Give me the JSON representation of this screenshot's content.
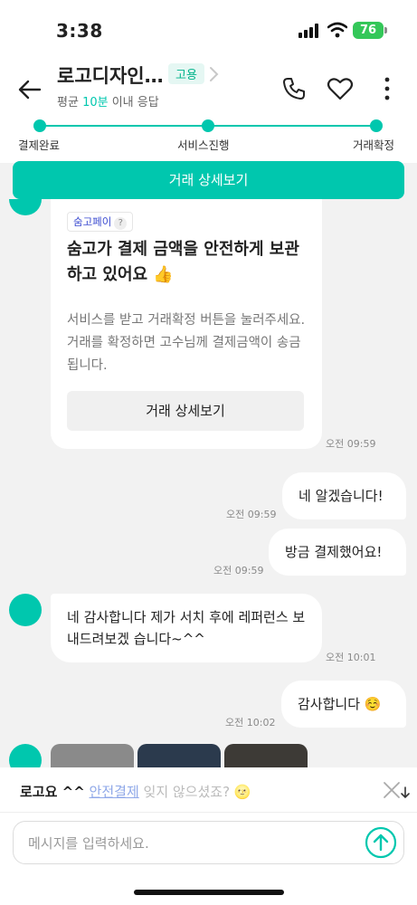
{
  "status_bar": {
    "time": "3:38",
    "battery": "76"
  },
  "header": {
    "title": "로고디자인…",
    "badge": "고용",
    "subtitle_prefix": "평균 ",
    "subtitle_accent": "10분",
    "subtitle_suffix": " 이내 응답"
  },
  "progress": {
    "steps": [
      {
        "label": "결제완료"
      },
      {
        "label": "서비스진행"
      },
      {
        "label": "거래확정"
      }
    ]
  },
  "banner": {
    "label": "거래 상세보기"
  },
  "card": {
    "chip": "숨고페이",
    "help": "?",
    "title": "숨고가 결제 금액을 안전하게 보관하고 있어요 👍",
    "body": "서비스를 받고 거래확정 버튼을 눌러주세요. 거래를 확정하면 고수님께 결제금액이 송금됩니다.",
    "button": "거래 상세보기",
    "time": "오전 09:59"
  },
  "messages": [
    {
      "from": "me",
      "text": "네 알겠습니다!",
      "time": "오전 09:59"
    },
    {
      "from": "me",
      "text": "방금 결제했어요!",
      "time": "오전 09:59"
    },
    {
      "from": "them",
      "text": "네 감사합니다 제가 서치 후에 레퍼런스 보내드려보겠 습니다~^^",
      "time": "오전 10:01"
    },
    {
      "from": "me",
      "text": "감사합니다 ☺️",
      "time": "오전 10:02"
    }
  ],
  "suggestion": {
    "strong": "로고요 ^^",
    "link": "안전결제",
    "rest": " 잊지 않으셨죠? 🌝"
  },
  "composer": {
    "placeholder": "메시지를 입력하세요."
  },
  "colors": {
    "accent": "#00c7ae",
    "chat_bg": "#f2f2f2",
    "battery": "#34c759"
  },
  "icons": [
    "back-arrow-icon",
    "chevron-right-icon",
    "phone-icon",
    "heart-icon",
    "more-vertical-icon",
    "send-arrow-icon",
    "close-icon"
  ]
}
